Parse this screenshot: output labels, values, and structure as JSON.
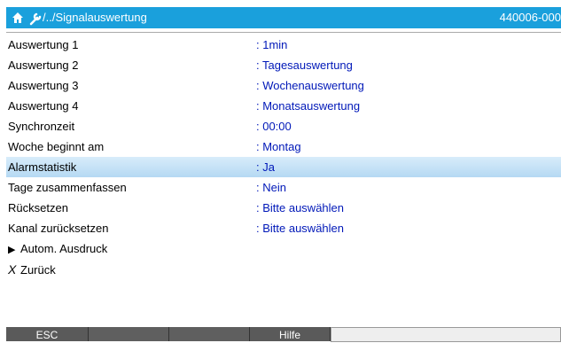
{
  "header": {
    "path": "/../Signalauswertung",
    "device_id": "440006-000"
  },
  "menu": {
    "items": [
      {
        "label": "Auswertung 1",
        "value": ": 1min"
      },
      {
        "label": "Auswertung 2",
        "value": ": Tagesauswertung"
      },
      {
        "label": "Auswertung 3",
        "value": ": Wochenauswertung"
      },
      {
        "label": "Auswertung 4",
        "value": ": Monatsauswertung"
      },
      {
        "label": "Synchronzeit",
        "value": ": 00:00"
      },
      {
        "label": "Woche beginnt am",
        "value": ": Montag"
      },
      {
        "label": "Alarmstatistik",
        "value": ": Ja"
      },
      {
        "label": "Tage zusammenfassen",
        "value": ": Nein"
      },
      {
        "label": "Rücksetzen",
        "value": ": Bitte auswählen"
      },
      {
        "label": "Kanal zurücksetzen",
        "value": ": Bitte auswählen"
      }
    ],
    "submenu_label": "Autom. Ausdruck",
    "back_label": "Zurück",
    "selected_index": 6
  },
  "softkeys": {
    "esc": "ESC",
    "help": "Hilfe"
  },
  "icons": {
    "home": "home-icon",
    "wrench": "wrench-icon",
    "submenu": "triangle-right-icon",
    "back": "x-back-icon"
  },
  "colors": {
    "titlebar": "#1aa0dc",
    "value_text": "#0018b8",
    "selection": "#c6e3f7",
    "softkey": "#5a5a5a"
  }
}
